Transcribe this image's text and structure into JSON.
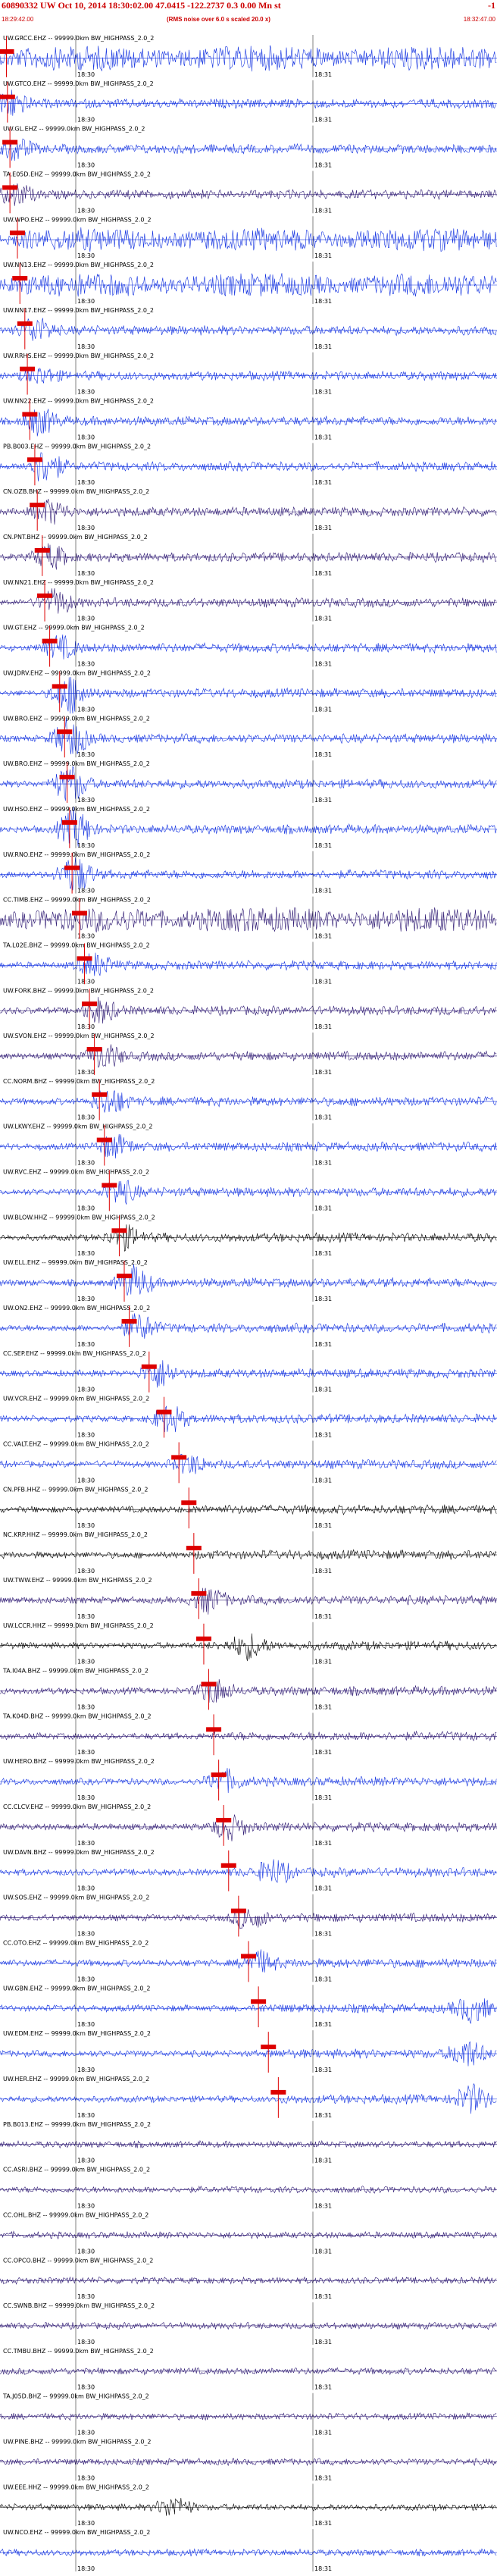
{
  "header": {
    "title": "60890332 UW Oct 10, 2014 18:30:02.00    47.0415 -122.2737   0.3 0.00 Mn st",
    "title_suffix": "-1",
    "start_time": "18:29:42.00",
    "note": "(RMS noise over 6.0 s scaled 20.0 x)",
    "end_time": "18:32:47.00"
  },
  "tick_labels": [
    "18:30",
    "18:31"
  ],
  "colors": {
    "pick": "#dd0000",
    "blue": "#1030e0",
    "purple": "#2a1570",
    "black": "#000000",
    "header": "#cc0000"
  },
  "traces": [
    {
      "label": "UW.GRCC.EHZ -- 99999.0km BW_HIGHPASS_2.0_2",
      "color": "blue",
      "pick": 0.013,
      "burst": 0.0,
      "amp": 1.0
    },
    {
      "label": "UW.GTCO.EHZ -- 99999.0km BW_HIGHPASS_2.0_2",
      "color": "blue",
      "pick": 0.015,
      "burst": 0.02,
      "amp": 0.6
    },
    {
      "label": "UW.GL.EHZ -- 99999.0km BW_HIGHPASS_2.0_2",
      "color": "blue",
      "pick": 0.02,
      "burst": 0.03,
      "amp": 0.5
    },
    {
      "label": "TA.E05D.EHZ -- 99999.0km BW_HIGHPASS_2.0_2",
      "color": "purple",
      "pick": 0.02,
      "burst": 0.03,
      "amp": 0.5
    },
    {
      "label": "UW.WPO.EHZ -- 99999.0km BW_HIGHPASS_2.0_2",
      "color": "blue",
      "pick": 0.035,
      "burst": 0.0,
      "amp": 0.9
    },
    {
      "label": "UW.NN13.EHZ -- 99999.0km BW_HIGHPASS_2.0_2",
      "color": "blue",
      "pick": 0.04,
      "burst": 0.0,
      "amp": 0.9
    },
    {
      "label": "UW.NN17.EHZ -- 99999.0km BW_HIGHPASS_2.0_2",
      "color": "blue",
      "pick": 0.05,
      "burst": 0.07,
      "amp": 0.6
    },
    {
      "label": "UW.RRHS.EHZ -- 99999.0km BW_HIGHPASS_2.0_2",
      "color": "blue",
      "pick": 0.055,
      "burst": 0.08,
      "amp": 0.35
    },
    {
      "label": "UW.NN22.EHZ -- 99999.0km BW_HIGHPASS_2.0_2",
      "color": "blue",
      "pick": 0.06,
      "burst": 0.08,
      "amp": 0.6
    },
    {
      "label": "PB.B003.EHZ -- 99999.0km BW_HIGHPASS_2.0_2",
      "color": "blue",
      "pick": 0.07,
      "burst": 0.09,
      "amp": 0.8
    },
    {
      "label": "CN.OZB.BHZ -- 99999.0km BW_HIGHPASS_2.0_2",
      "color": "purple",
      "pick": 0.075,
      "burst": 0.1,
      "amp": 0.55
    },
    {
      "label": "CN.PNT.BHZ -- 99999.0km BW_HIGHPASS_2.0_2",
      "color": "purple",
      "pick": 0.085,
      "burst": 0.1,
      "amp": 0.55
    },
    {
      "label": "UW.NN21.EHZ -- 99999.0km BW_HIGHPASS_2.0_2",
      "color": "purple",
      "pick": 0.09,
      "burst": 0.11,
      "amp": 0.55
    },
    {
      "label": "UW.GT.EHZ -- 99999.0km BW_HIGHPASS_2.0_2",
      "color": "blue",
      "pick": 0.1,
      "burst": 0.12,
      "amp": 0.5
    },
    {
      "label": "UW.JDRV.EHZ -- 99999.0km BW_HIGHPASS_2.0_2",
      "color": "blue",
      "pick": 0.12,
      "burst": 0.14,
      "amp": 0.9
    },
    {
      "label": "UW.BRO.EHZ -- 99999.0km BW_HIGHPASS_2.0_2",
      "color": "blue",
      "pick": 0.13,
      "burst": 0.14,
      "amp": 0.9
    },
    {
      "label": "UW.BRO.EHZ -- 99999.0km BW_HIGHPASS_2.0_2",
      "color": "blue",
      "pick": 0.135,
      "burst": 0.14,
      "amp": 0.9
    },
    {
      "label": "UW.HSO.EHZ -- 99999.0km BW_HIGHPASS_2.0_2",
      "color": "blue",
      "pick": 0.14,
      "burst": 0.15,
      "amp": 0.9
    },
    {
      "label": "UW.RNO.EHZ -- 99999.0km BW_HIGHPASS_2.0_2",
      "color": "blue",
      "pick": 0.145,
      "burst": 0.15,
      "amp": 0.9
    },
    {
      "label": "CC.TIMB.EHZ -- 99999.0km BW_HIGHPASS_2.0_2",
      "color": "purple",
      "pick": 0.16,
      "burst": 0.0,
      "amp": 1.0
    },
    {
      "label": "TA.L02E.BHZ -- 99999.0km BW_HIGHPASS_2.0_2",
      "color": "blue",
      "pick": 0.17,
      "burst": 0.19,
      "amp": 0.5
    },
    {
      "label": "UW.FORK.BHZ -- 99999.0km BW_HIGHPASS_2.0_2",
      "color": "purple",
      "pick": 0.18,
      "burst": 0.2,
      "amp": 0.55
    },
    {
      "label": "UW.SVON.EHZ -- 99999.0km BW_HIGHPASS_2.0_2",
      "color": "purple",
      "pick": 0.19,
      "burst": 0.21,
      "amp": 0.55
    },
    {
      "label": "CC.NORM.BHZ -- 99999.0km BW_HIGHPASS_2.0_2",
      "color": "blue",
      "pick": 0.2,
      "burst": 0.22,
      "amp": 0.6
    },
    {
      "label": "UW.LKWY.EHZ -- 99999.0km BW_HIGHPASS_2.0_2",
      "color": "blue",
      "pick": 0.21,
      "burst": 0.23,
      "amp": 0.5
    },
    {
      "label": "UW.RVC.EHZ -- 99999.0km BW_HIGHPASS_2.0_2",
      "color": "blue",
      "pick": 0.22,
      "burst": 0.24,
      "amp": 0.55
    },
    {
      "label": "UW.BLOW.HHZ -- 99999.0km BW_HIGHPASS_2.0_2",
      "color": "black",
      "pick": 0.24,
      "burst": 0.25,
      "amp": 0.5
    },
    {
      "label": "UW.ELL.EHZ -- 99999.0km BW_HIGHPASS_2.0_2",
      "color": "blue",
      "pick": 0.25,
      "burst": 0.27,
      "amp": 0.7
    },
    {
      "label": "UW.ON2.EHZ -- 99999.0km BW_HIGHPASS_2.0_2",
      "color": "blue",
      "pick": 0.26,
      "burst": 0.28,
      "amp": 0.6
    },
    {
      "label": "CC.SEP.EHZ -- 99999.0km BW_HIGHPASS_2.0_2",
      "color": "blue",
      "pick": 0.3,
      "burst": 0.32,
      "amp": 0.6
    },
    {
      "label": "UW.VCR.EHZ -- 99999.0km BW_HIGHPASS_2.0_2",
      "color": "blue",
      "pick": 0.33,
      "burst": 0.34,
      "amp": 0.6
    },
    {
      "label": "CC.VALT.EHZ -- 99999.0km BW_HIGHPASS_2.0_2",
      "color": "blue",
      "pick": 0.36,
      "burst": 0.38,
      "amp": 0.4
    },
    {
      "label": "CN.PFB.HHZ -- 99999.0km BW_HIGHPASS_2.0_2",
      "color": "black",
      "pick": 0.38,
      "burst": 0.0,
      "amp": 0.7
    },
    {
      "label": "NC.KRP.HHZ -- 99999.0km BW_HIGHPASS_2.0_2",
      "color": "black",
      "pick": 0.39,
      "burst": 0.0,
      "amp": 0.7
    },
    {
      "label": "UW.TWW.EHZ -- 99999.0km BW_HIGHPASS_2.0_2",
      "color": "purple",
      "pick": 0.4,
      "burst": 0.42,
      "amp": 0.55
    },
    {
      "label": "UW.LCCR.HHZ -- 99999.0km BW_HIGHPASS_2.0_2",
      "color": "black",
      "pick": 0.41,
      "burst": 0.5,
      "amp": 0.55
    },
    {
      "label": "TA.I04A.BHZ -- 99999.0km BW_HIGHPASS_2.0_2",
      "color": "purple",
      "pick": 0.42,
      "burst": 0.43,
      "amp": 0.55
    },
    {
      "label": "TA.K04D.BHZ -- 99999.0km BW_HIGHPASS_2.0_2",
      "color": "purple",
      "pick": 0.43,
      "burst": 0.0,
      "amp": 0.8
    },
    {
      "label": "UW.HERO.BHZ -- 99999.0km BW_HIGHPASS_2.0_2",
      "color": "blue",
      "pick": 0.44,
      "burst": 0.45,
      "amp": 0.5
    },
    {
      "label": "CC.CLCV.EHZ -- 99999.0km BW_HIGHPASS_2.0_2",
      "color": "purple",
      "pick": 0.45,
      "burst": 0.46,
      "amp": 0.55
    },
    {
      "label": "UW.DAVN.BHZ -- 99999.0km BW_HIGHPASS_2.0_2",
      "color": "blue",
      "pick": 0.46,
      "burst": 0.55,
      "amp": 0.55
    },
    {
      "label": "UW.SOS.EHZ -- 99999.0km BW_HIGHPASS_2.0_2",
      "color": "purple",
      "pick": 0.48,
      "burst": 0.5,
      "amp": 0.5
    },
    {
      "label": "CC.OTO.EHZ -- 99999.0km BW_HIGHPASS_2.0_2",
      "color": "blue",
      "pick": 0.5,
      "burst": 0.52,
      "amp": 0.5
    },
    {
      "label": "UW.GBN.EHZ -- 99999.0km BW_HIGHPASS_2.0_2",
      "color": "blue",
      "pick": 0.52,
      "burst": 0.95,
      "amp": 0.6
    },
    {
      "label": "UW.EDM.EHZ -- 99999.0km BW_HIGHPASS_2.0_2",
      "color": "blue",
      "pick": 0.54,
      "burst": 0.94,
      "amp": 0.6
    },
    {
      "label": "UW.HER.EHZ -- 99999.0km BW_HIGHPASS_2.0_2",
      "color": "blue",
      "pick": 0.56,
      "burst": 0.95,
      "amp": 0.6
    },
    {
      "label": "PB.B013.EHZ -- 99999.0km BW_HIGHPASS_2.0_2",
      "color": "purple",
      "pick": 0.0,
      "burst": 0.0,
      "amp": 0.5
    },
    {
      "label": "CC.ASRI.BHZ -- 99999.0km BW_HIGHPASS_2.0_2",
      "color": "purple",
      "pick": 0.0,
      "burst": 0.0,
      "amp": 0.5
    },
    {
      "label": "CC.OHL.BHZ -- 99999.0km BW_HIGHPASS_2.0_2",
      "color": "purple",
      "pick": 0.0,
      "burst": 0.0,
      "amp": 0.5
    },
    {
      "label": "CC.OPCO.BHZ -- 99999.0km BW_HIGHPASS_2.0_2",
      "color": "purple",
      "pick": 0.0,
      "burst": 0.0,
      "amp": 0.5
    },
    {
      "label": "CC.SWNB.BHZ -- 99999.0km BW_HIGHPASS_2.0_2",
      "color": "purple",
      "pick": 0.0,
      "burst": 0.0,
      "amp": 0.5
    },
    {
      "label": "CC.TMBU.BHZ -- 99999.0km BW_HIGHPASS_2.0_2",
      "color": "purple",
      "pick": 0.0,
      "burst": 0.0,
      "amp": 0.5
    },
    {
      "label": "TA.J05D.BHZ -- 99999.0km BW_HIGHPASS_2.0_2",
      "color": "purple",
      "pick": 0.0,
      "burst": 0.0,
      "amp": 0.5
    },
    {
      "label": "UW.PINE.BHZ -- 99999.0km BW_HIGHPASS_2.0_2",
      "color": "purple",
      "pick": 0.0,
      "burst": 0.0,
      "amp": 0.5
    },
    {
      "label": "UW.EEE.HHZ -- 99999.0km BW_HIGHPASS_2.0_2",
      "color": "black",
      "pick": 0.0,
      "burst": 0.35,
      "amp": 0.5
    },
    {
      "label": "UW.NCO.EHZ -- 99999.0km BW_HIGHPASS_2.0_2",
      "color": "blue",
      "pick": 0.0,
      "burst": 0.0,
      "amp": 0.5
    }
  ]
}
